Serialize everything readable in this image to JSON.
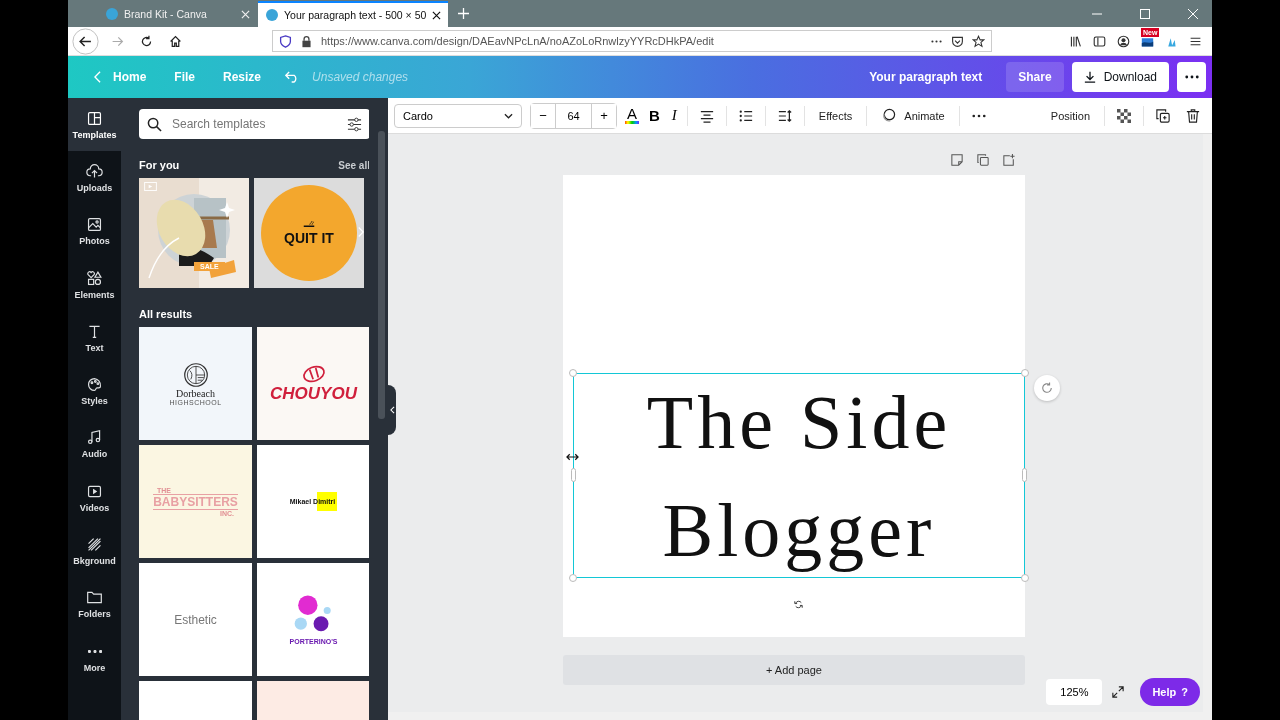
{
  "browser": {
    "tabs": [
      {
        "label": "Brand Kit - Canva",
        "selected": false
      },
      {
        "label": "Your paragraph text - 500 × 50",
        "selected": true
      }
    ],
    "url": "https://www.canva.com/design/DAEavNPcLnA/noAZoLoRnwlzyYYRcDHkPA/edit",
    "extension_badge": "New"
  },
  "topbar": {
    "home": "Home",
    "menu": [
      "File",
      "Resize"
    ],
    "status": "Unsaved changes",
    "title": "Your paragraph text",
    "share": "Share",
    "download": "Download"
  },
  "rail": [
    {
      "kind": "templates",
      "label": "Templates",
      "selected": true
    },
    {
      "kind": "uploads",
      "label": "Uploads",
      "selected": false
    },
    {
      "kind": "photos",
      "label": "Photos",
      "selected": false
    },
    {
      "kind": "elements",
      "label": "Elements",
      "selected": false
    },
    {
      "kind": "text",
      "label": "Text",
      "selected": false
    },
    {
      "kind": "styles",
      "label": "Styles",
      "selected": false
    },
    {
      "kind": "audio",
      "label": "Audio",
      "selected": false
    },
    {
      "kind": "videos",
      "label": "Videos",
      "selected": false
    },
    {
      "kind": "background",
      "label": "Bkground",
      "selected": false
    },
    {
      "kind": "folders",
      "label": "Folders",
      "selected": false
    },
    {
      "kind": "more",
      "label": "More",
      "selected": false
    }
  ],
  "panel": {
    "search": {
      "placeholder": "Search templates"
    },
    "for_you": "For you",
    "see_all": "See all",
    "featured": [
      {
        "kind": "photo-sale",
        "badge": "SALE"
      },
      {
        "kind": "quit",
        "title": "QUIT IT"
      }
    ],
    "all_results": "All results",
    "templates": [
      {
        "kind": "dorbeach",
        "color": "#f2f6fa",
        "title": "Dorbeach",
        "subtitle": "HIGHSCHOOL"
      },
      {
        "kind": "chouyou",
        "color": "#fbf8f4",
        "title": "CHOUYOU"
      },
      {
        "kind": "babysitters",
        "color": "#fbf6e2",
        "pre": "THE",
        "title": "BABYSITTERS",
        "subtitle": "INC."
      },
      {
        "kind": "mikael",
        "color": "#ffffff",
        "title": "Mikael Dimitri"
      },
      {
        "kind": "esthetic",
        "color": "#ffffff",
        "title": "Esthetic"
      },
      {
        "kind": "porterino",
        "color": "#ffffff",
        "title": "PORTERINO'S"
      },
      {
        "kind": "blank",
        "color": "#ffffff"
      },
      {
        "kind": "blank",
        "color": "#fdebe4"
      }
    ]
  },
  "toolbar": {
    "font": "Cardo",
    "size": "64",
    "minus": "−",
    "plus": "+",
    "color_glyph": "A",
    "bold": "B",
    "italic": "I",
    "effects": "Effects",
    "animate": "Animate",
    "position": "Position"
  },
  "canvas": {
    "text": "The Side Blogger",
    "add_page": "+ Add page",
    "zoom": "125%",
    "help": "Help",
    "help_mark": "?"
  }
}
